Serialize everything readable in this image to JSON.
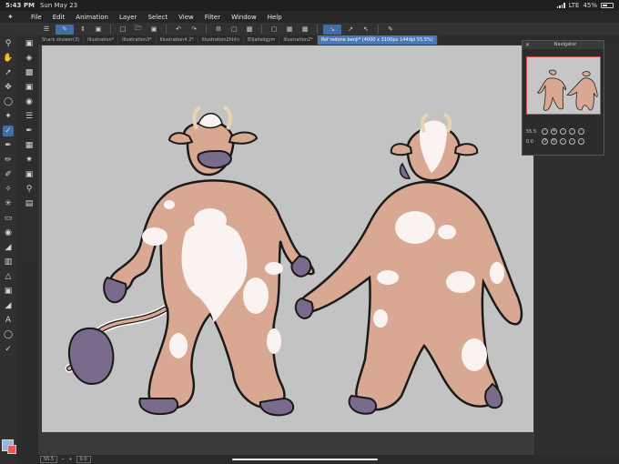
{
  "status_bar": {
    "time": "5:43 PM",
    "date": "Sun May 23",
    "network": "LTE",
    "battery": "45%"
  },
  "menu": [
    "File",
    "Edit",
    "Animation",
    "Layer",
    "Select",
    "View",
    "Filter",
    "Window",
    "Help"
  ],
  "tabs": [
    "Shark shower(3)",
    "Illustration*",
    "Illustration3*",
    "Illustration4 2*",
    "Illustration2hhh)",
    "Elijahsögym",
    "Illustration2*",
    "Ref redone benji* (4000 x 3100px 144dpi 55.5%)"
  ],
  "active_tab_index": 7,
  "navigator": {
    "title": "Navigator",
    "zoom": "55.5",
    "rotation": "0.0"
  },
  "bottom_bar": {
    "zoom": "55.5",
    "rotation": "0.0"
  },
  "colors": {
    "accent": "#3f6ea8",
    "cow_skin": "#d9a892",
    "cow_spots": "#faf3f1",
    "hooves": "#7a6a8c",
    "outline": "#1a1a1a",
    "canvas": "#c3c3c3"
  }
}
